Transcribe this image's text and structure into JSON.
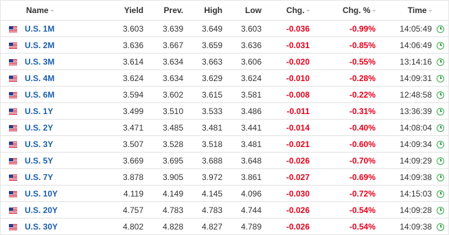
{
  "columns": {
    "name": "Name",
    "yield": "Yield",
    "prev": "Prev.",
    "high": "High",
    "low": "Low",
    "chg": "Chg.",
    "chg_pct": "Chg. %",
    "time": "Time"
  },
  "sort_glyph": "÷",
  "colors": {
    "negative": "#e3001b",
    "link": "#1a5ea8",
    "clock": "#3aa84a"
  },
  "rows": [
    {
      "name": "U.S. 1M",
      "yield": "3.603",
      "prev": "3.639",
      "high": "3.649",
      "low": "3.603",
      "chg": "-0.036",
      "chg_pct": "-0.99%",
      "time": "14:05:49"
    },
    {
      "name": "U.S. 2M",
      "yield": "3.636",
      "prev": "3.667",
      "high": "3.659",
      "low": "3.636",
      "chg": "-0.031",
      "chg_pct": "-0.85%",
      "time": "14:06:49"
    },
    {
      "name": "U.S. 3M",
      "yield": "3.614",
      "prev": "3.634",
      "high": "3.663",
      "low": "3.606",
      "chg": "-0.020",
      "chg_pct": "-0.55%",
      "time": "13:14:16"
    },
    {
      "name": "U.S. 4M",
      "yield": "3.624",
      "prev": "3.634",
      "high": "3.629",
      "low": "3.624",
      "chg": "-0.010",
      "chg_pct": "-0.28%",
      "time": "14:09:31"
    },
    {
      "name": "U.S. 6M",
      "yield": "3.594",
      "prev": "3.602",
      "high": "3.615",
      "low": "3.581",
      "chg": "-0.008",
      "chg_pct": "-0.22%",
      "time": "12:48:58"
    },
    {
      "name": "U.S. 1Y",
      "yield": "3.499",
      "prev": "3.510",
      "high": "3.533",
      "low": "3.486",
      "chg": "-0.011",
      "chg_pct": "-0.31%",
      "time": "13:36:39"
    },
    {
      "name": "U.S. 2Y",
      "yield": "3.471",
      "prev": "3.485",
      "high": "3.481",
      "low": "3.441",
      "chg": "-0.014",
      "chg_pct": "-0.40%",
      "time": "14:08:04"
    },
    {
      "name": "U.S. 3Y",
      "yield": "3.507",
      "prev": "3.528",
      "high": "3.518",
      "low": "3.481",
      "chg": "-0.021",
      "chg_pct": "-0.60%",
      "time": "14:09:34"
    },
    {
      "name": "U.S. 5Y",
      "yield": "3.669",
      "prev": "3.695",
      "high": "3.688",
      "low": "3.648",
      "chg": "-0.026",
      "chg_pct": "-0.70%",
      "time": "14:09:29"
    },
    {
      "name": "U.S. 7Y",
      "yield": "3.878",
      "prev": "3.905",
      "high": "3.972",
      "low": "3.861",
      "chg": "-0.027",
      "chg_pct": "-0.69%",
      "time": "14:09:38"
    },
    {
      "name": "U.S. 10Y",
      "yield": "4.119",
      "prev": "4.149",
      "high": "4.145",
      "low": "4.096",
      "chg": "-0.030",
      "chg_pct": "-0.72%",
      "time": "14:15:03"
    },
    {
      "name": "U.S. 20Y",
      "yield": "4.757",
      "prev": "4.783",
      "high": "4.783",
      "low": "4.744",
      "chg": "-0.026",
      "chg_pct": "-0.54%",
      "time": "14:09:28"
    },
    {
      "name": "U.S. 30Y",
      "yield": "4.802",
      "prev": "4.828",
      "high": "4.827",
      "low": "4.789",
      "chg": "-0.026",
      "chg_pct": "-0.54%",
      "time": "14:09:38"
    }
  ]
}
